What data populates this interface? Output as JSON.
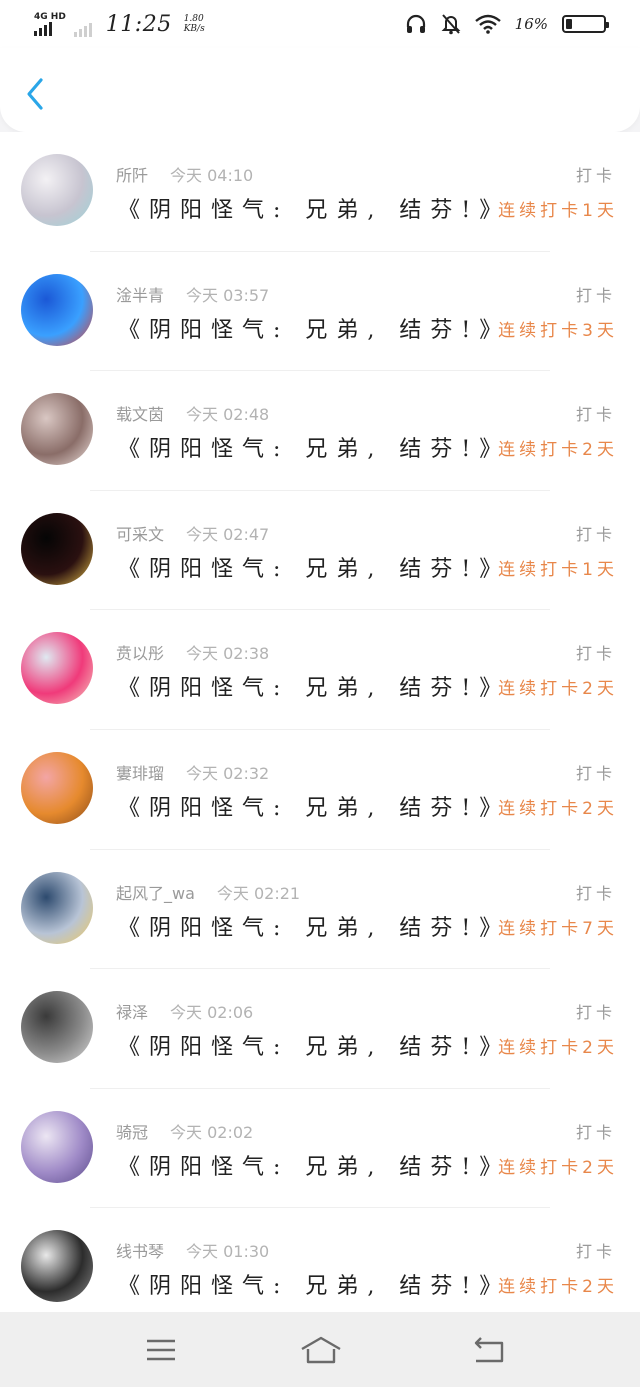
{
  "status_bar": {
    "network": "4G HD",
    "time": "11:25",
    "speed_value": "1.80",
    "speed_unit": "KB/s",
    "battery_percent": "16%",
    "battery_level": 0.16
  },
  "header": {
    "back_icon": "chevron-left-icon",
    "accent": "#2aa6e8"
  },
  "colors": {
    "streak": "#e8874a",
    "meta": "#9a9a9a",
    "title": "#222222"
  },
  "feed": [
    {
      "user": "所阡",
      "time": "今天 04:10",
      "title": "《阴阳怪气: 兄弟, 结芬!》",
      "action": "打卡",
      "streak": "连续打卡1天",
      "avatar_colors": [
        "#f3f1f4",
        "#c7c4d0",
        "#9ad4d8"
      ]
    },
    {
      "user": "淦半青",
      "time": "今天 03:57",
      "title": "《阴阳怪气: 兄弟, 结芬!》",
      "action": "打卡",
      "streak": "连续打卡3天",
      "avatar_colors": [
        "#1b58d6",
        "#3aa0ff",
        "#e23b2e"
      ]
    },
    {
      "user": "载文茵",
      "time": "今天 02:48",
      "title": "《阴阳怪气: 兄弟, 结芬!》",
      "action": "打卡",
      "streak": "连续打卡2天",
      "avatar_colors": [
        "#d9c7c3",
        "#8a6d68",
        "#efe2de"
      ]
    },
    {
      "user": "可采文",
      "time": "今天 02:47",
      "title": "《阴阳怪气: 兄弟, 结芬!》",
      "action": "打卡",
      "streak": "连续打卡1天",
      "avatar_colors": [
        "#050505",
        "#2a1010",
        "#e8c24a"
      ]
    },
    {
      "user": "贲以彤",
      "time": "今天 02:38",
      "title": "《阴阳怪气: 兄弟, 结芬!》",
      "action": "打卡",
      "streak": "连续打卡2天",
      "avatar_colors": [
        "#dfe9f1",
        "#f03a7a",
        "#f4d1c2"
      ]
    },
    {
      "user": "寠琲瑠",
      "time": "今天 02:32",
      "title": "《阴阳怪气: 兄弟, 结芬!》",
      "action": "打卡",
      "streak": "连续打卡2天",
      "avatar_colors": [
        "#f3a5a5",
        "#e68a2e",
        "#8a4a18"
      ]
    },
    {
      "user": "起风了_wa",
      "time": "今天 02:21",
      "title": "《阴阳怪气: 兄弟, 结芬!》",
      "action": "打卡",
      "streak": "连续打卡7天",
      "avatar_colors": [
        "#2d4a6e",
        "#b8c4d6",
        "#f0c95a"
      ]
    },
    {
      "user": "禄泽",
      "time": "今天 02:06",
      "title": "《阴阳怪气: 兄弟, 结芬!》",
      "action": "打卡",
      "streak": "连续打卡2天",
      "avatar_colors": [
        "#3a3a3a",
        "#8a8a8a",
        "#d8d8d8"
      ]
    },
    {
      "user": "骑冠",
      "time": "今天 02:02",
      "title": "《阴阳怪气: 兄弟, 结芬!》",
      "action": "打卡",
      "streak": "连续打卡2天",
      "avatar_colors": [
        "#ece6f3",
        "#9f8ac7",
        "#5a4a8a"
      ]
    },
    {
      "user": "线书琴",
      "time": "今天 01:30",
      "title": "《阴阳怪气: 兄弟, 结芬!》",
      "action": "打卡",
      "streak": "连续打卡2天",
      "avatar_colors": [
        "#e9e9e9",
        "#2c2c2c",
        "#8c8c8c"
      ]
    }
  ],
  "system_nav": {
    "menu_icon": "menu-icon",
    "home_icon": "home-icon",
    "back_icon": "back-return-icon"
  }
}
